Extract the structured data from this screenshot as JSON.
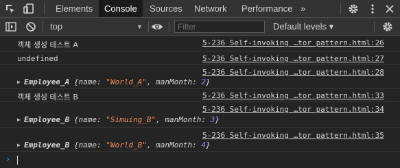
{
  "tabs": [
    "Elements",
    "Console",
    "Sources",
    "Network",
    "Performance"
  ],
  "active_tab": "Console",
  "overflow_tabs": "»",
  "toolbar": {
    "context": "top",
    "filter_placeholder": "Filter",
    "levels": "Default levels ▾"
  },
  "console": [
    {
      "type": "text",
      "kr": true,
      "text": "객체 생성 테스트 A",
      "source": "5-236 Self-invoking …tor pattern.html:26"
    },
    {
      "type": "text",
      "kr": false,
      "text": "undefined",
      "source": "5-236 Self-invoking …tor pattern.html:27"
    },
    {
      "type": "object",
      "class": "Employee_A",
      "props": [
        {
          "k": "name",
          "v": "\"World_A\"",
          "t": "s"
        },
        {
          "k": "manMonth",
          "v": "2",
          "t": "n"
        }
      ],
      "source": "5-236 Self-invoking …tor pattern.html:28"
    },
    {
      "type": "text",
      "kr": true,
      "text": "객체 생성 테스트 B",
      "source": "5-236 Self-invoking …tor pattern.html:33"
    },
    {
      "type": "object",
      "class": "Employee_B",
      "props": [
        {
          "k": "name",
          "v": "\"Simuing_B\"",
          "t": "s"
        },
        {
          "k": "manMonth",
          "v": "3",
          "t": "n"
        }
      ],
      "source": "5-236 Self-invoking …tor pattern.html:34"
    },
    {
      "type": "object",
      "class": "Employee_B",
      "props": [
        {
          "k": "name",
          "v": "\"World_B\"",
          "t": "s"
        },
        {
          "k": "manMonth",
          "v": "4",
          "t": "n"
        }
      ],
      "source": "5-236 Self-invoking …tor pattern.html:35"
    }
  ],
  "prompt_symbol": "›"
}
